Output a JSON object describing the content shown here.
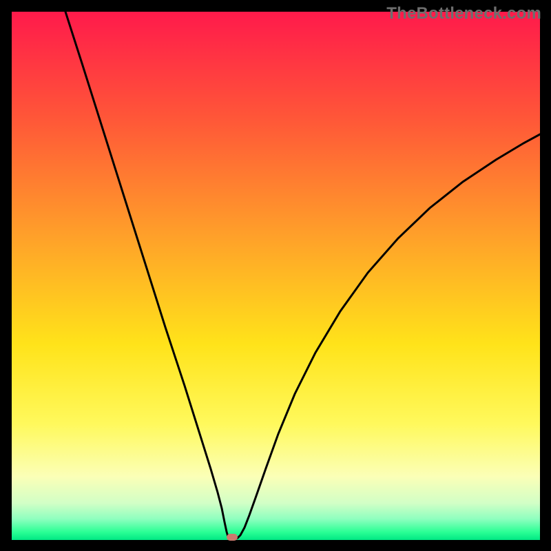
{
  "watermark": "TheBottleneck.com",
  "chart_data": {
    "type": "line",
    "title": "",
    "xlabel": "",
    "ylabel": "",
    "xlim": [
      17,
      784
    ],
    "ylim": [
      17,
      784
    ],
    "grid": false,
    "gradient_stops": [
      {
        "offset": 0.0,
        "color": "#ff1a4b"
      },
      {
        "offset": 0.2,
        "color": "#ff5638"
      },
      {
        "offset": 0.43,
        "color": "#ffa229"
      },
      {
        "offset": 0.63,
        "color": "#ffe31a"
      },
      {
        "offset": 0.78,
        "color": "#fff95c"
      },
      {
        "offset": 0.88,
        "color": "#fbffb7"
      },
      {
        "offset": 0.93,
        "color": "#d2ffc6"
      },
      {
        "offset": 0.96,
        "color": "#8fffbf"
      },
      {
        "offset": 0.985,
        "color": "#2bff95"
      },
      {
        "offset": 1.0,
        "color": "#00e884"
      }
    ],
    "series": [
      {
        "name": "bottleneck-curve",
        "color": "#000000",
        "width": 3,
        "points": [
          [
            95,
            17
          ],
          [
            120,
            95
          ],
          [
            150,
            190
          ],
          [
            180,
            285
          ],
          [
            210,
            380
          ],
          [
            240,
            475
          ],
          [
            268,
            560
          ],
          [
            290,
            630
          ],
          [
            306,
            681
          ],
          [
            316,
            715
          ],
          [
            322,
            738
          ],
          [
            326,
            758
          ],
          [
            329,
            772
          ],
          [
            331,
            779
          ],
          [
            333,
            783
          ],
          [
            337,
            783
          ],
          [
            341,
            783
          ],
          [
            345,
            781
          ],
          [
            349,
            777
          ],
          [
            355,
            766
          ],
          [
            362,
            748
          ],
          [
            372,
            720
          ],
          [
            386,
            680
          ],
          [
            404,
            630
          ],
          [
            428,
            572
          ],
          [
            458,
            512
          ],
          [
            494,
            452
          ],
          [
            534,
            396
          ],
          [
            578,
            346
          ],
          [
            624,
            302
          ],
          [
            672,
            264
          ],
          [
            720,
            232
          ],
          [
            760,
            208
          ],
          [
            784,
            195
          ]
        ]
      }
    ],
    "marker": {
      "x": 337,
      "y": 780,
      "width": 16,
      "height": 10,
      "rx": 5,
      "color": "#cc7a6e"
    }
  }
}
